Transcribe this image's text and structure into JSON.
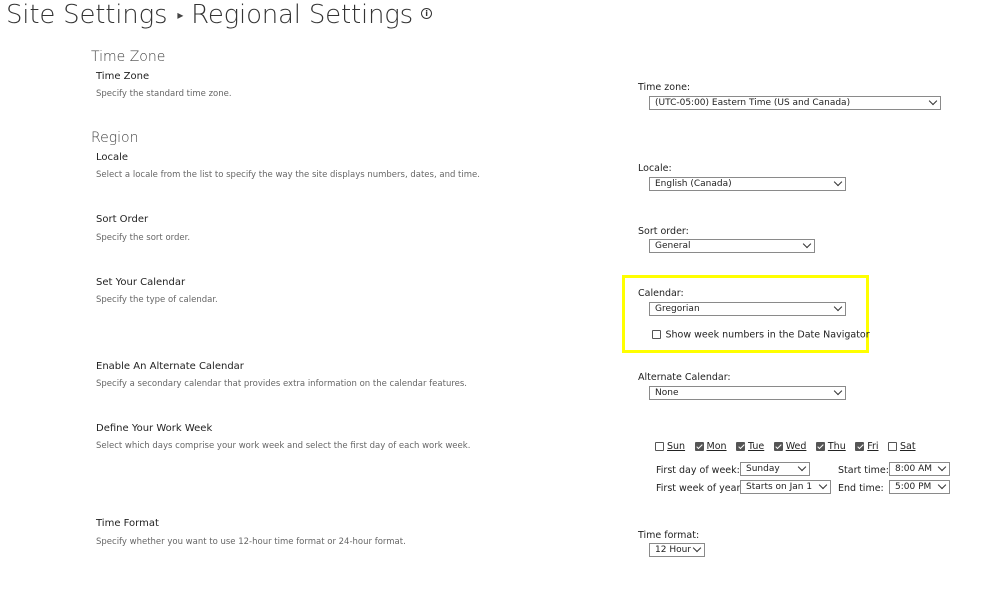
{
  "breadcrumb": {
    "root": "Site Settings",
    "page": "Regional Settings"
  },
  "groups": {
    "time_zone": "Time Zone",
    "region": "Region"
  },
  "sections": {
    "time_zone": {
      "title": "Time Zone",
      "description": "Specify the standard time zone.",
      "field_label": "Time zone:",
      "value": "(UTC-05:00) Eastern Time (US and Canada)"
    },
    "locale": {
      "title": "Locale",
      "description": "Select a locale from the list to specify the way the site displays numbers, dates, and time.",
      "field_label": "Locale:",
      "value": "English (Canada)"
    },
    "sort_order": {
      "title": "Sort Order",
      "description": "Specify the sort order.",
      "field_label": "Sort order:",
      "value": "General"
    },
    "calendar": {
      "title": "Set Your Calendar",
      "description": "Specify the type of calendar.",
      "field_label": "Calendar:",
      "value": "Gregorian",
      "week_numbers_label": "Show week numbers in the Date Navigator",
      "week_numbers_checked": false
    },
    "alternate_calendar": {
      "title": "Enable An Alternate Calendar",
      "description": "Specify a secondary calendar that provides extra information on the calendar features.",
      "field_label": "Alternate Calendar:",
      "value": "None"
    },
    "work_week": {
      "title": "Define Your Work Week",
      "description": "Select which days comprise your work week and select the first day of each work week.",
      "days": [
        {
          "label": "Sun",
          "checked": false
        },
        {
          "label": "Mon",
          "checked": true
        },
        {
          "label": "Tue",
          "checked": true
        },
        {
          "label": "Wed",
          "checked": true
        },
        {
          "label": "Thu",
          "checked": true
        },
        {
          "label": "Fri",
          "checked": true
        },
        {
          "label": "Sat",
          "checked": false
        }
      ],
      "first_day_label": "First day of week:",
      "first_day_value": "Sunday",
      "first_week_label": "First week of year:",
      "first_week_value": "Starts on Jan 1",
      "start_time_label": "Start time:",
      "start_time_value": "8:00 AM",
      "end_time_label": "End time:",
      "end_time_value": "5:00 PM"
    },
    "time_format": {
      "title": "Time Format",
      "description": "Specify whether you want to use 12-hour time format or 24-hour format.",
      "field_label": "Time format:",
      "value": "12 Hour"
    }
  },
  "colors": {
    "highlight": "#ffff00"
  },
  "icons": {
    "info": "info-icon",
    "breadcrumb_separator": "caret-right-icon"
  }
}
